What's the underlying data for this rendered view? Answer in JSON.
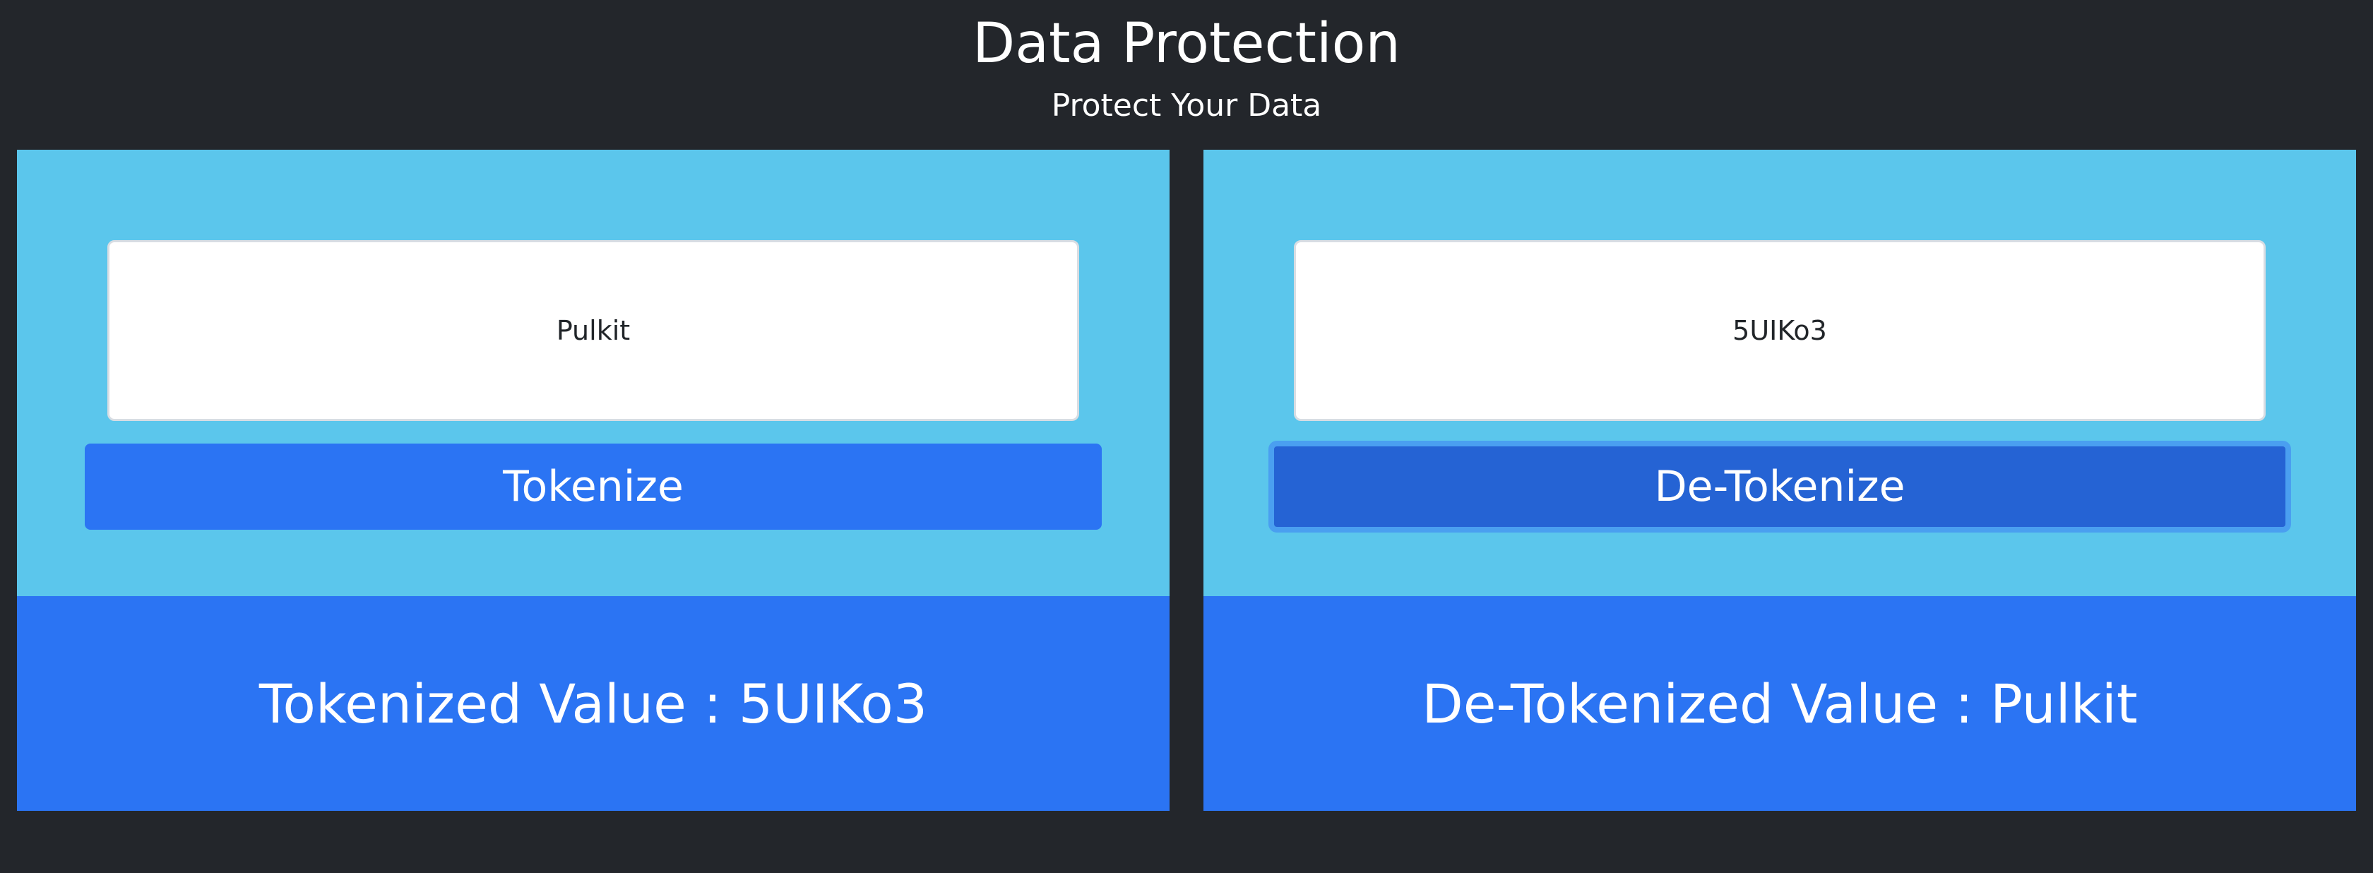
{
  "header": {
    "title": "Data Protection",
    "subtitle": "Protect Your Data"
  },
  "tokenize_panel": {
    "input_value": "Pulkit",
    "button_label": "Tokenize",
    "result_text": "Tokenized Value : 5UIKo3"
  },
  "detokenize_panel": {
    "input_value": "5UIKo3",
    "button_label": "De-Tokenize",
    "result_text": "De-Tokenized Value : Pulkit"
  },
  "colors": {
    "background": "#23262b",
    "panel_top": "#5bc6ec",
    "panel_bottom": "#2b74f3",
    "button": "#2b74f3",
    "button_focused": "#2563d4"
  }
}
